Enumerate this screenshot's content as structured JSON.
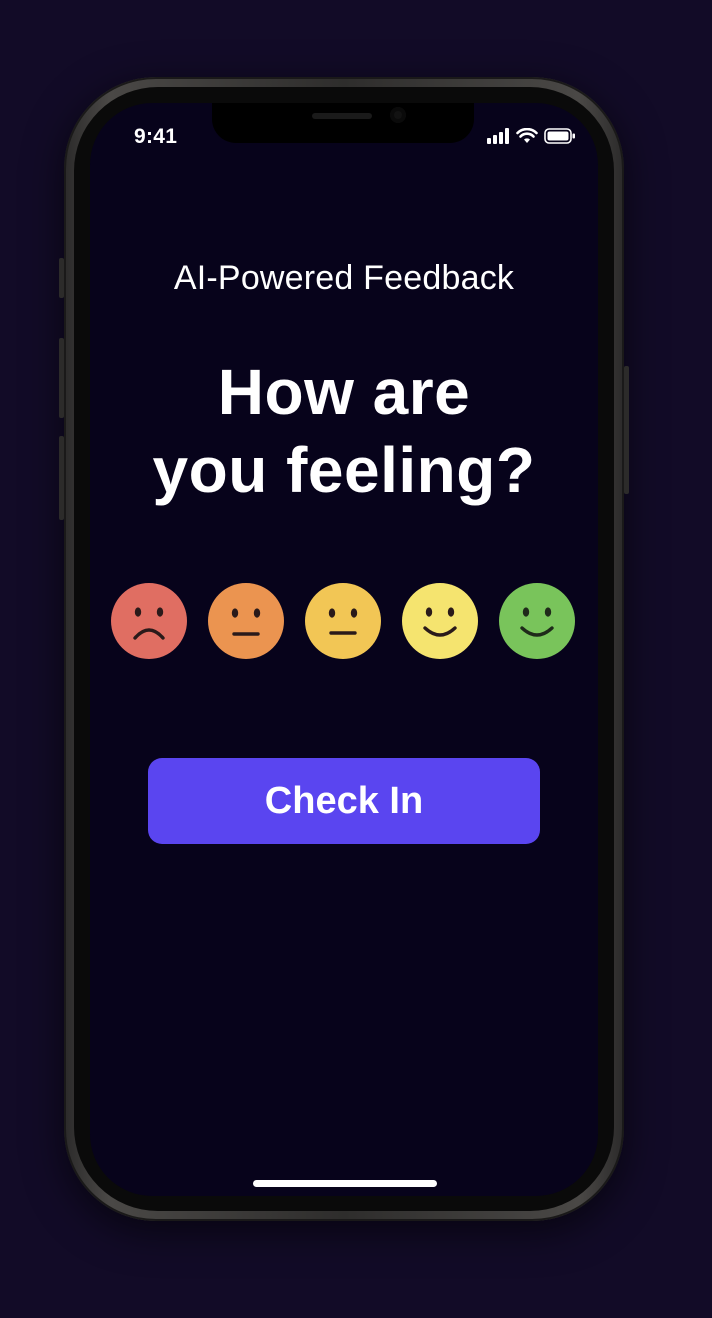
{
  "status_bar": {
    "time": "9:41",
    "icons": [
      "cellular-signal-icon",
      "wifi-icon",
      "battery-icon"
    ]
  },
  "screen": {
    "subtitle": "AI-Powered Feedback",
    "headline_line1": "How are",
    "headline_line2": "you feeling?",
    "moods": [
      {
        "name": "sad-face-icon",
        "color": "#e06e62"
      },
      {
        "name": "unhappy-neutral-face-icon",
        "color": "#eb9450"
      },
      {
        "name": "neutral-face-icon",
        "color": "#f2c655"
      },
      {
        "name": "slight-smile-face-icon",
        "color": "#f5e46f"
      },
      {
        "name": "happy-face-icon",
        "color": "#79c45b"
      }
    ],
    "check_in_label": "Check In"
  },
  "colors": {
    "background": "#120b27",
    "screen": "#07031b",
    "accent": "#5a45f0",
    "text": "#ffffff"
  }
}
